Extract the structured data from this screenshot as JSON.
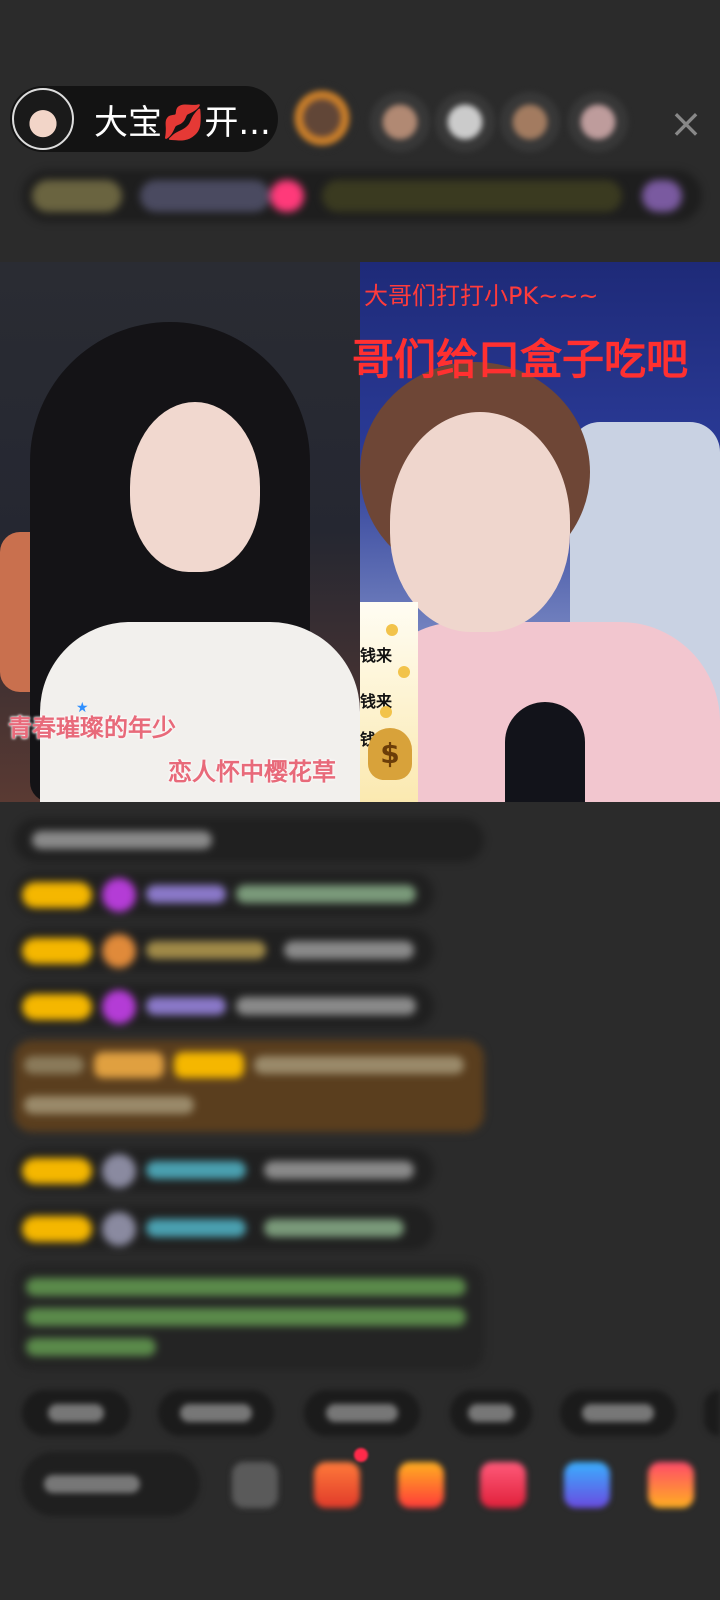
{
  "header": {
    "host_name": "大宝💋开...",
    "close_icon": "×"
  },
  "pk": {
    "right_banner_line1": "大哥们打打小PK~~~",
    "right_banner_line2": "哥们给口盒子吃吧",
    "coin_banner": {
      "lines": [
        "钱来",
        "钱来",
        "钱来"
      ],
      "bag_symbol": "$"
    },
    "left_lyrics": {
      "line1": "青春璀璨的年少",
      "line2": "恋人怀中樱花草"
    },
    "star_symbol": "★"
  },
  "colors": {
    "background": "#2b2b2b",
    "lyric": "#e86a7a",
    "banner_red": "#ff3030",
    "badge_gold": "#f5b700"
  }
}
